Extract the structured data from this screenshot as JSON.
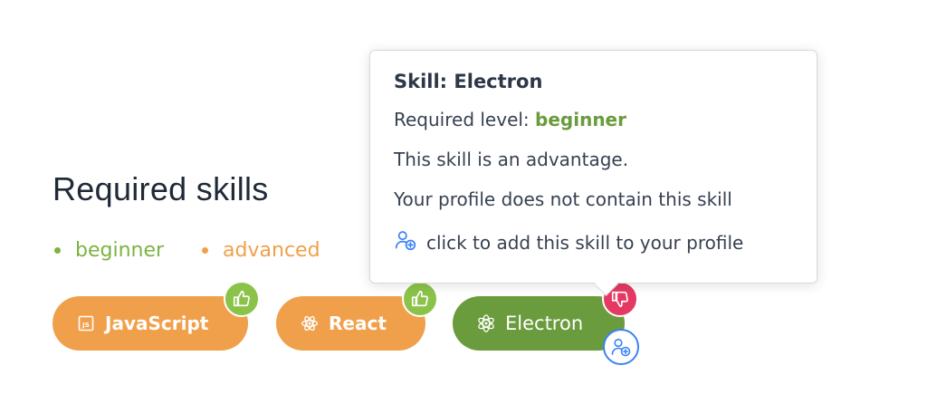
{
  "section": {
    "title": "Required skills"
  },
  "legend": {
    "beginner": "beginner",
    "advanced": "advanced"
  },
  "skills": [
    {
      "name": "JavaScript",
      "icon": "js-file-icon",
      "level": "advanced",
      "badge": "thumbs-up-icon"
    },
    {
      "name": "React",
      "icon": "atom-icon",
      "level": "advanced",
      "badge": "thumbs-up-icon"
    },
    {
      "name": "Electron",
      "icon": "electron-icon",
      "level": "beginner",
      "badge": "thumbs-down-icon",
      "extra_badge": "user-add-icon"
    }
  ],
  "tooltip": {
    "title": "Skill: Electron",
    "level_prefix": "Required level: ",
    "level_value": "beginner",
    "advantage": "This skill is an advantage.",
    "profile_status": "Your profile does not contain this skill",
    "add_action": "click to add this skill to your profile"
  },
  "colors": {
    "advanced": "#f0a04b",
    "beginner": "#7cb342",
    "like_badge": "#8bc34a",
    "dislike_badge": "#e53963",
    "link_blue": "#3b82f6"
  }
}
